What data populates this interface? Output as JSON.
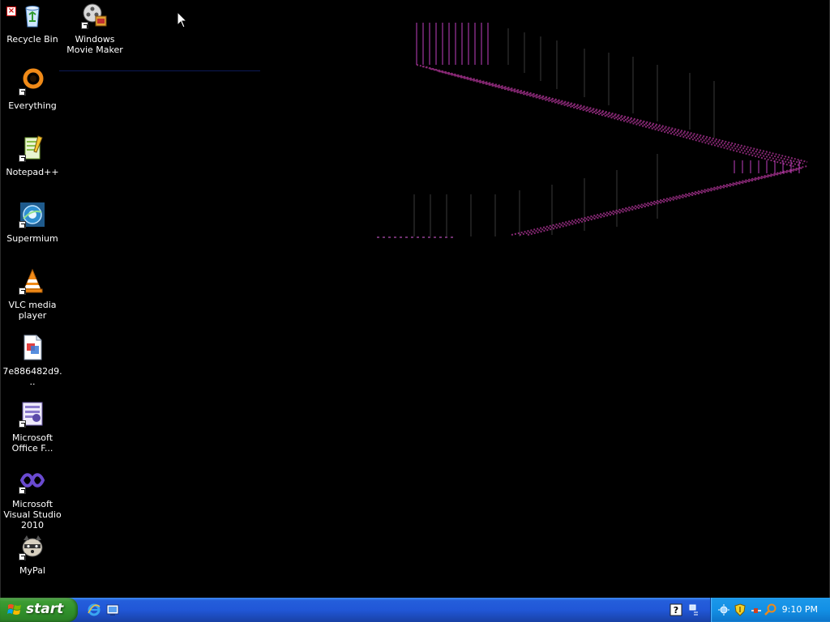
{
  "desktop": {
    "icons": [
      {
        "label": "Recycle Bin",
        "icon": "recycle-bin-icon"
      },
      {
        "label": "Windows Movie Maker",
        "icon": "movie-maker-icon"
      },
      {
        "label": "Everything",
        "icon": "everything-icon"
      },
      {
        "label": "Notepad++",
        "icon": "notepad-plus-plus-icon"
      },
      {
        "label": "Supermium",
        "icon": "supermium-icon"
      },
      {
        "label": "VLC media player",
        "icon": "vlc-icon"
      },
      {
        "label": "7e886482d9...",
        "icon": "image-file-icon"
      },
      {
        "label": "Microsoft Office F...",
        "icon": "office-icon"
      },
      {
        "label": "Microsoft Visual Studio 2010",
        "icon": "visual-studio-icon"
      },
      {
        "label": "MyPal",
        "icon": "mypal-icon"
      }
    ]
  },
  "taskbar": {
    "start_label": "start",
    "quick_launch": [
      "internet-explorer-icon",
      "show-desktop-icon"
    ],
    "tray_icons": [
      "help-icon",
      "network-icon",
      "antivirus-shield-icon",
      "connection-icon",
      "search-icon"
    ],
    "clock": "9:10 PM"
  },
  "colors": {
    "desktop_bg": "#000000",
    "taskbar_blue": "#245edb",
    "start_green": "#3c9c34",
    "tray_blue": "#1390e5",
    "artifact_magenta": "#c040c0"
  }
}
